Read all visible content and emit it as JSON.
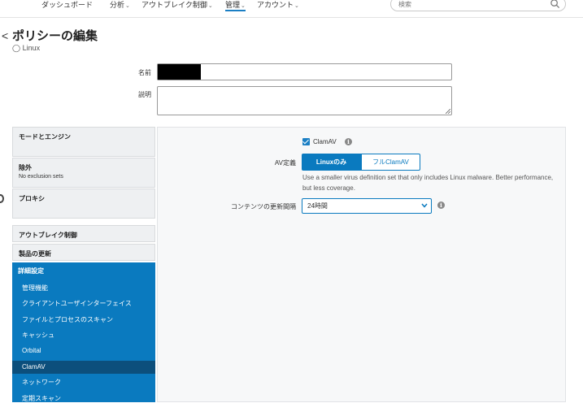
{
  "nav": {
    "items": [
      {
        "label": "ダッシュボード",
        "caret": false
      },
      {
        "label": "分析",
        "caret": true
      },
      {
        "label": "アウトブレイク制御",
        "caret": true
      },
      {
        "label": "管理",
        "caret": true,
        "active": true
      },
      {
        "label": "アカウント",
        "caret": true
      }
    ],
    "search_placeholder": "検索",
    "accent_color": "#1b7fc4"
  },
  "page": {
    "back_label": "<",
    "title": "ポリシーの編集",
    "os": "Linux"
  },
  "form": {
    "name_label": "名前",
    "name_value": "",
    "description_label": "説明",
    "description_value": ""
  },
  "sidebar": {
    "mode_engine": "モードとエンジン",
    "exclusions": "除外",
    "exclusions_sub": "No exclusion sets",
    "proxy": "プロキシ",
    "outbreak_control": "アウトブレイク制御",
    "product_updates": "製品の更新",
    "advanced": {
      "heading": "詳細設定",
      "items": [
        "管理機能",
        "クライアントユーザインターフェイス",
        "ファイルとプロセスのスキャン",
        "キャッシュ",
        "Orbital",
        "ClamAV",
        "ネットワーク",
        "定期スキャン"
      ],
      "selected": "ClamAV",
      "panel_color": "#0a7abf",
      "selected_color": "#0c4f7c"
    }
  },
  "main": {
    "clamav_checkbox_label": "ClamAV",
    "clamav_checked": true,
    "av_definitions_label": "AV定義",
    "av_options": [
      "Linuxのみ",
      "フルClamAV"
    ],
    "av_selected": "Linuxのみ",
    "av_help": "Use a smaller virus definition set that only includes Linux malware. Better performance, but less coverage.",
    "content_update_label": "コンテンツの更新間隔",
    "content_update_value": "24時間"
  }
}
